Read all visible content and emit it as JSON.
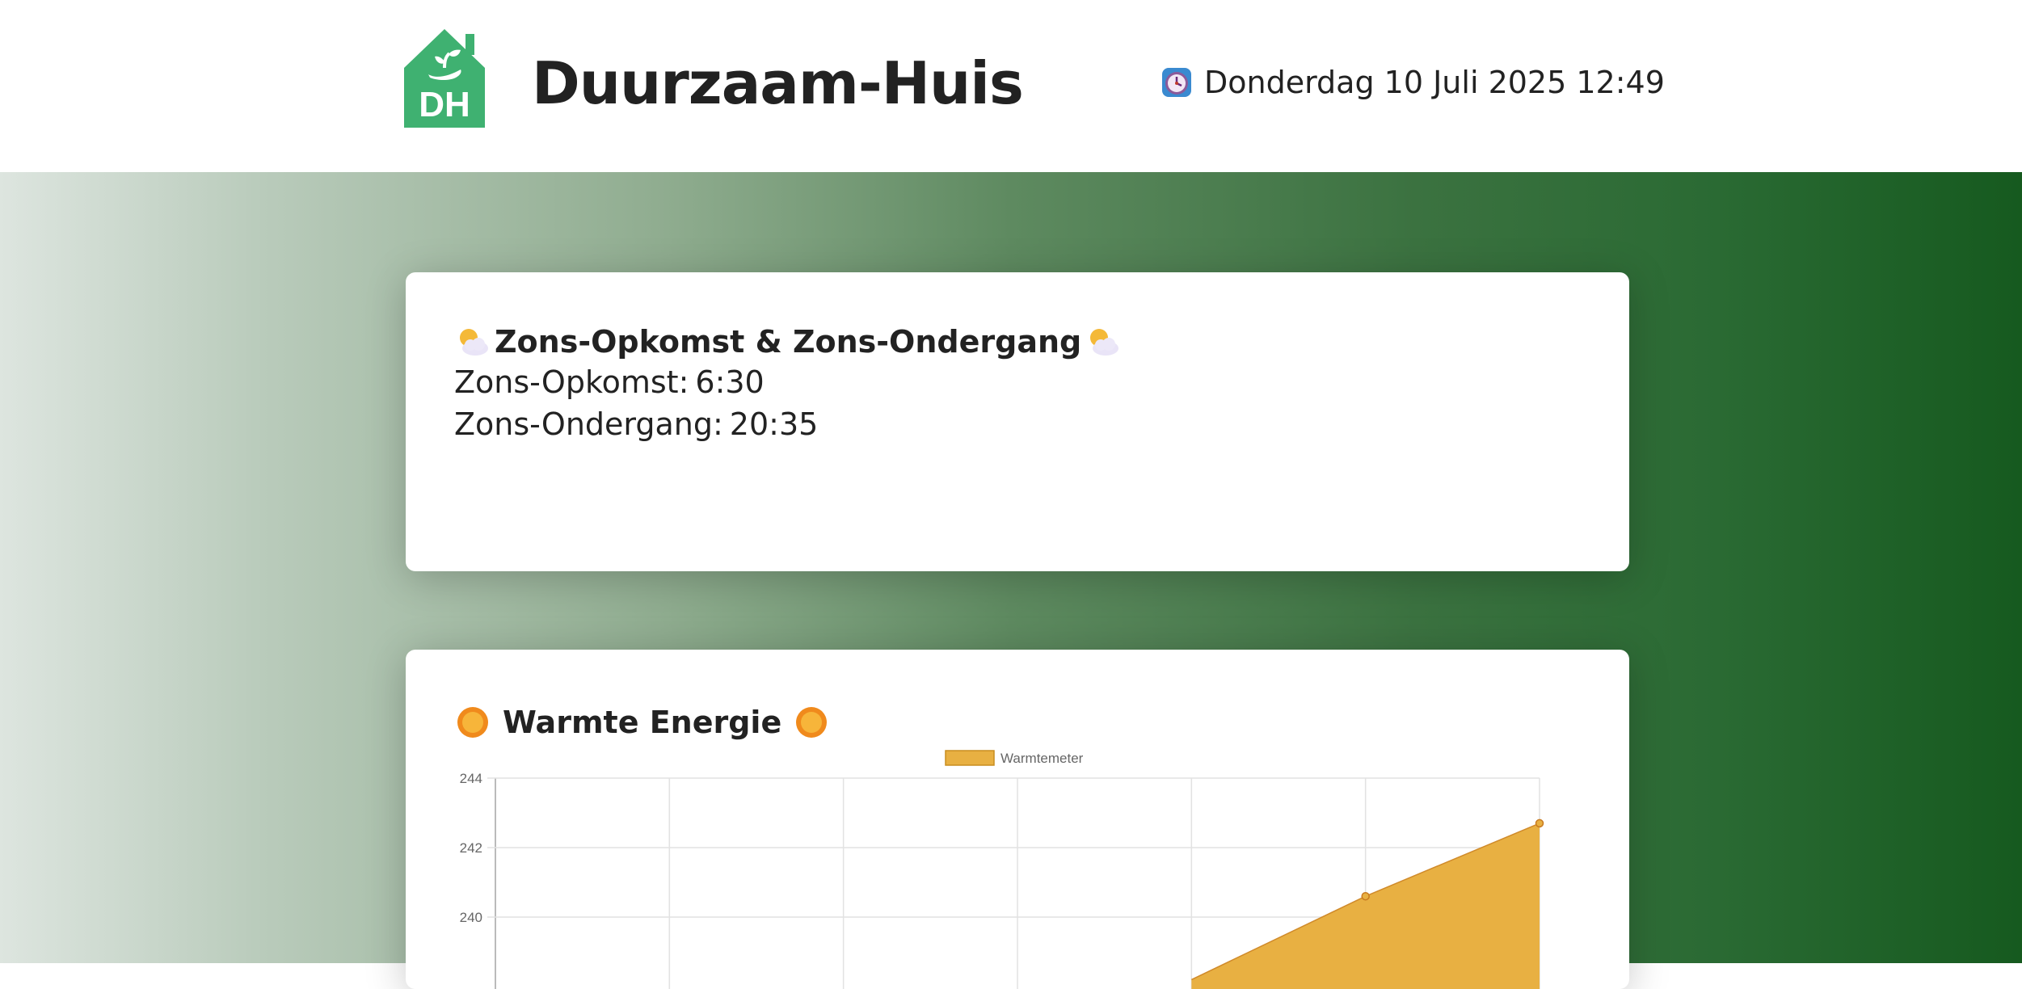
{
  "header": {
    "logo_text": "DH",
    "site_title": "Duurzaam-Huis",
    "datetime": "Donderdag 10 Juli 2025 12:49",
    "clock_icon": "alarm-clock-icon"
  },
  "sun_card": {
    "title": "Zons-Opkomst & Zons-Ondergang",
    "title_icon": "sun-behind-cloud-icon",
    "sunrise_label": "Zons-Opkomst:",
    "sunrise_value": "6:30",
    "sunset_label": "Zons-Ondergang:",
    "sunset_value": "20:35"
  },
  "heat_card": {
    "title": "Warmte Energie",
    "title_icon": "sun-icon"
  },
  "chart_data": {
    "type": "area",
    "series": [
      {
        "name": "Warmtemeter",
        "color": "#e8b042",
        "points_visible": [
          238.2,
          240.6,
          242.7
        ]
      }
    ],
    "ytick_labels": [
      "244",
      "242",
      "240"
    ],
    "ylim": [
      238,
      244
    ],
    "grid": true,
    "legend": "top-center"
  },
  "colors": {
    "brand_green": "#3fb171",
    "hero_gradient_end": "#165a1f",
    "area_fill": "#e8b042"
  }
}
